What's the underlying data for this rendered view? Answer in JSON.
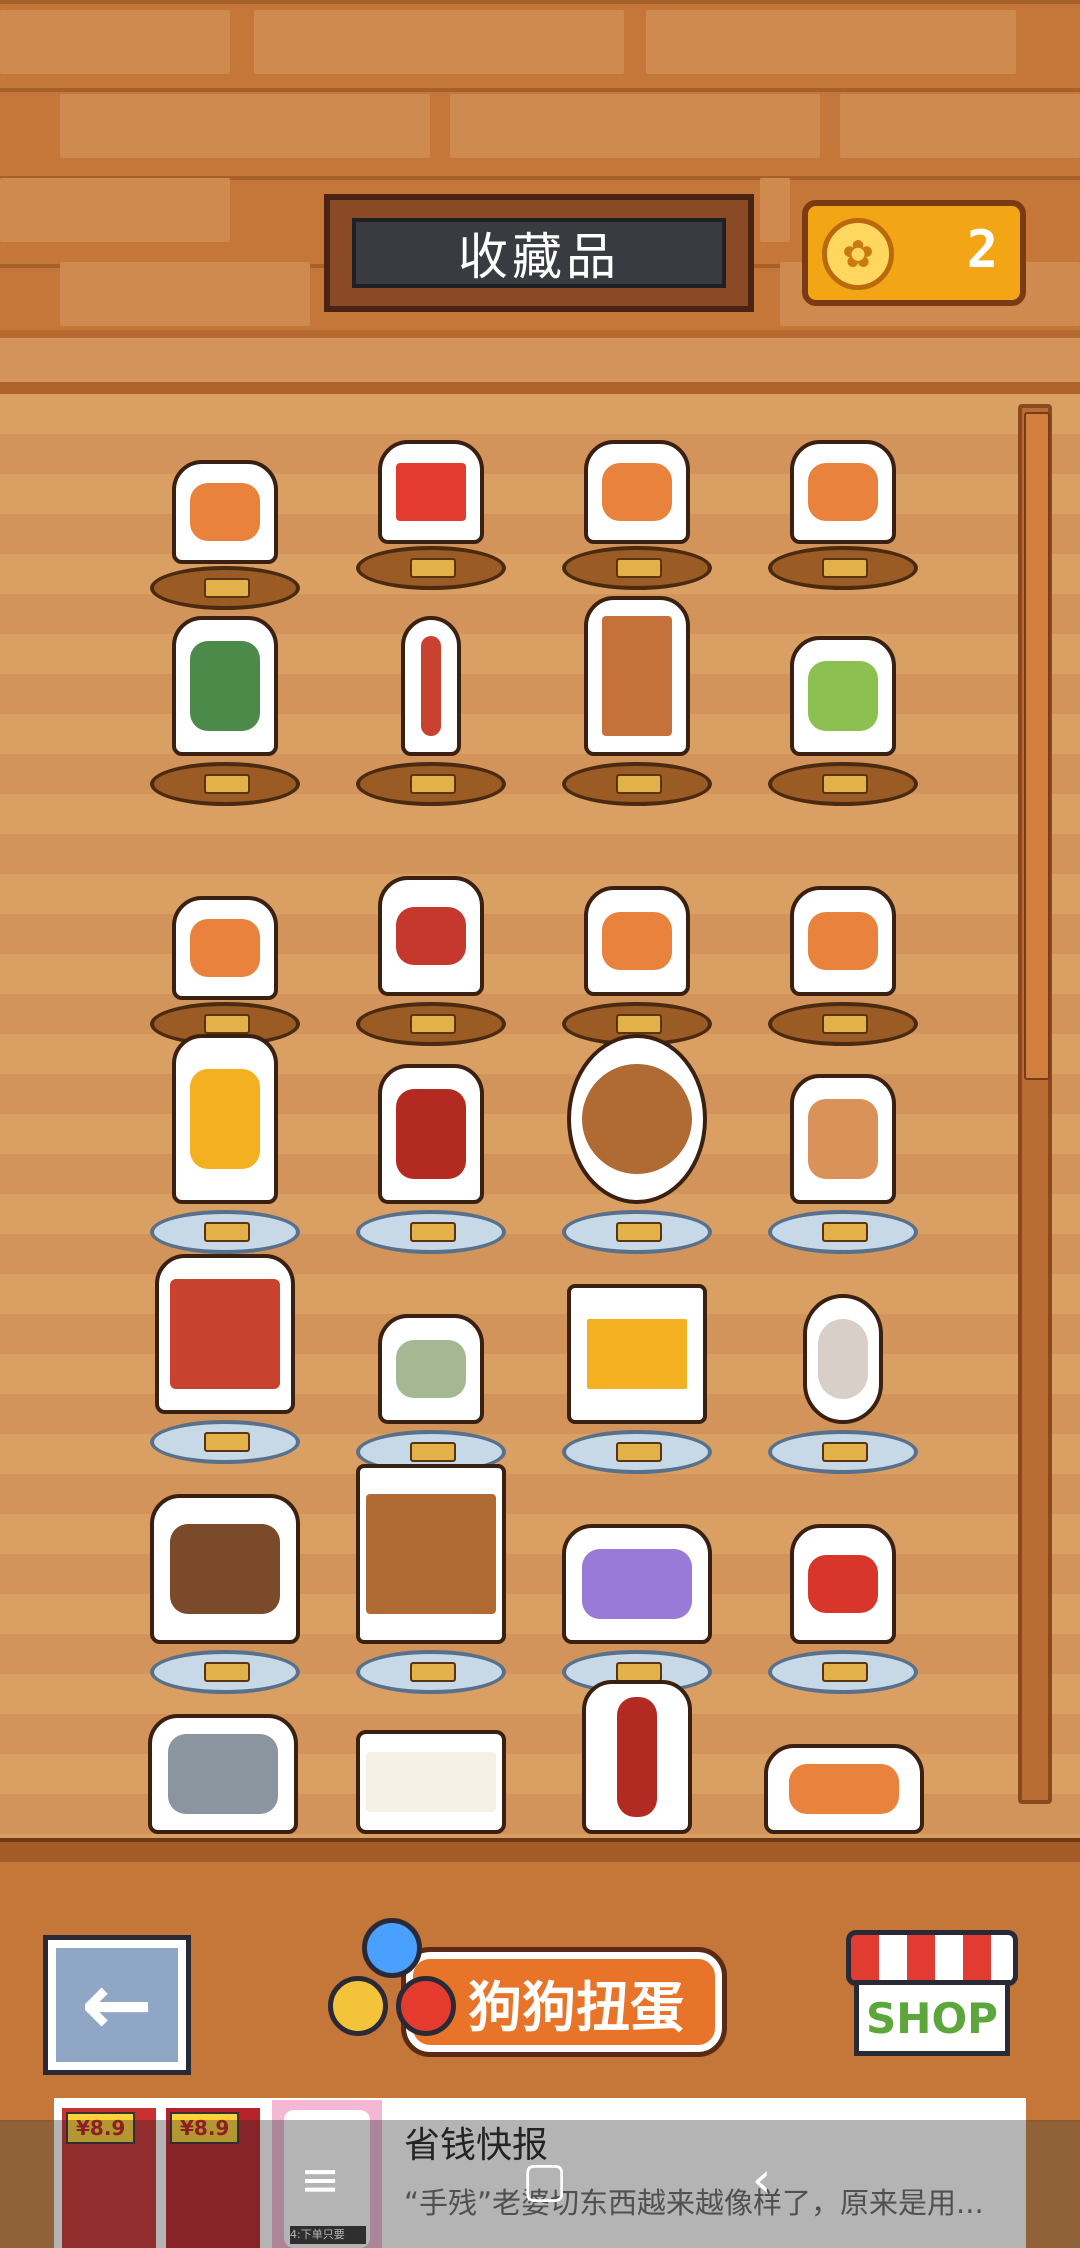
{
  "header": {
    "title": "收藏品",
    "coin_icon": "paw-coin-icon",
    "coin_count": "2"
  },
  "collection": {
    "rows": [
      [
        "shiba-figure",
        "framed-dog-picture",
        "shiba-figure",
        "shiba-with-bowl"
      ],
      [
        "shiba-with-cactus",
        "lamp-post",
        "wardrobe",
        "plant-on-stool"
      ],
      [
        "sleeping-shiba",
        "shiba-with-hat",
        "shiba-figure",
        "shiba-with-box"
      ],
      [
        "shiba-on-armchair",
        "shiba-on-sofa",
        "round-window",
        "shiba-on-couch"
      ],
      [
        "tv-cabinet",
        "green-dog-figure",
        "computer-monitor",
        "oval-mirror"
      ],
      [
        "shiba-with-speaker",
        "tv-stand",
        "shiba-with-flower-box",
        "shiba-on-cushion"
      ],
      [
        "boy-with-shiba",
        "dining-table",
        "skewer-shiba",
        "shiba-with-gacha-balls"
      ]
    ]
  },
  "buttons": {
    "back_icon": "arrow-left-icon",
    "gacha_label": "狗狗扭蛋",
    "shop_label": "SHOP"
  },
  "ad": {
    "price_1": "¥8.9",
    "price_2": "¥8.9",
    "phone_note": "4:下单只要",
    "title": "省钱快报",
    "description": "“手残”老婆切东西越来越像样了，原来是用..."
  },
  "navbar": {
    "menu_icon": "menu-icon",
    "home_icon": "home-icon",
    "back_icon": "back-chevron-icon"
  },
  "colors": {
    "wood_base": "#9a5c24",
    "crystal_base": "#c7d8e6",
    "gacha_orange": "#e8742a",
    "coin_gold": "#f2a515"
  }
}
